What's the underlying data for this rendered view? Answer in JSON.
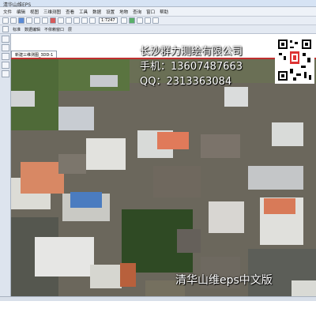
{
  "window": {
    "title": "清华山维EPS"
  },
  "menubar": {
    "items": [
      "文件",
      "编辑",
      "视图",
      "三维测图",
      "查看",
      "工具",
      "数据",
      "设置",
      "地物",
      "查询",
      "窗口",
      "帮助"
    ]
  },
  "toolbar": {
    "zoom": "1:7247"
  },
  "toolbar2": {
    "items": [
      "标准",
      "数据编辑",
      "不依赖窗口",
      "层"
    ]
  },
  "document_tab": {
    "label": "新建三维测图_3DD-1"
  },
  "overlay": {
    "company": "长沙群力测绘有限公司",
    "phone": "手机：13607487663",
    "qq": "QQ：2313363084",
    "caption": "清华山维eps中文版"
  },
  "colors": {
    "overlay_text": "#ffffff",
    "viewport_border": "#c03030",
    "titlebar": "#d6e3f4"
  },
  "icons": [
    "qr-code-icon"
  ]
}
